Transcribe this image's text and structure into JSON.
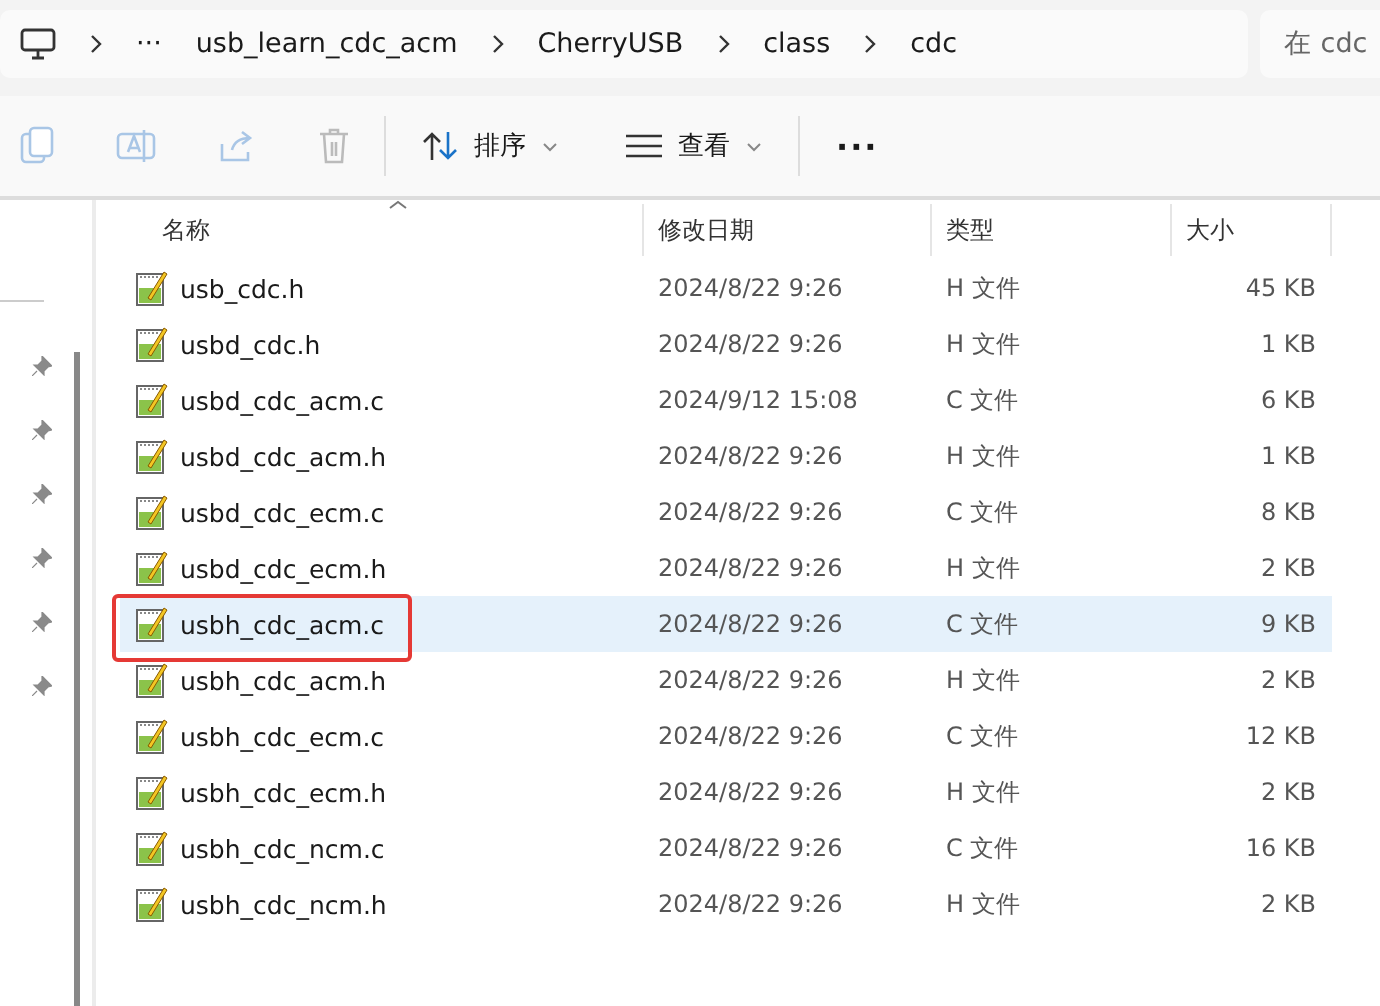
{
  "breadcrumb": {
    "overflow": "···",
    "items": [
      "usb_learn_cdc_acm",
      "CherryUSB",
      "class",
      "cdc"
    ]
  },
  "search": {
    "placeholder": "在 cdc"
  },
  "toolbar": {
    "sort": "排序",
    "view": "查看",
    "more": "···"
  },
  "table": {
    "columns": [
      "名称",
      "修改日期",
      "类型",
      "大小"
    ],
    "rows": [
      {
        "name": "usb_cdc.h",
        "date": "2024/8/22 9:26",
        "type": "H 文件",
        "size": "45 KB",
        "selected": false,
        "marked": false
      },
      {
        "name": "usbd_cdc.h",
        "date": "2024/8/22 9:26",
        "type": "H 文件",
        "size": "1 KB",
        "selected": false,
        "marked": false
      },
      {
        "name": "usbd_cdc_acm.c",
        "date": "2024/9/12 15:08",
        "type": "C 文件",
        "size": "6 KB",
        "selected": false,
        "marked": false
      },
      {
        "name": "usbd_cdc_acm.h",
        "date": "2024/8/22 9:26",
        "type": "H 文件",
        "size": "1 KB",
        "selected": false,
        "marked": false
      },
      {
        "name": "usbd_cdc_ecm.c",
        "date": "2024/8/22 9:26",
        "type": "C 文件",
        "size": "8 KB",
        "selected": false,
        "marked": false
      },
      {
        "name": "usbd_cdc_ecm.h",
        "date": "2024/8/22 9:26",
        "type": "H 文件",
        "size": "2 KB",
        "selected": false,
        "marked": false
      },
      {
        "name": "usbh_cdc_acm.c",
        "date": "2024/8/22 9:26",
        "type": "C 文件",
        "size": "9 KB",
        "selected": true,
        "marked": true
      },
      {
        "name": "usbh_cdc_acm.h",
        "date": "2024/8/22 9:26",
        "type": "H 文件",
        "size": "2 KB",
        "selected": false,
        "marked": false
      },
      {
        "name": "usbh_cdc_ecm.c",
        "date": "2024/8/22 9:26",
        "type": "C 文件",
        "size": "12 KB",
        "selected": false,
        "marked": false
      },
      {
        "name": "usbh_cdc_ecm.h",
        "date": "2024/8/22 9:26",
        "type": "H 文件",
        "size": "2 KB",
        "selected": false,
        "marked": false
      },
      {
        "name": "usbh_cdc_ncm.c",
        "date": "2024/8/22 9:26",
        "type": "C 文件",
        "size": "16 KB",
        "selected": false,
        "marked": false
      },
      {
        "name": "usbh_cdc_ncm.h",
        "date": "2024/8/22 9:26",
        "type": "H 文件",
        "size": "2 KB",
        "selected": false,
        "marked": false
      }
    ]
  }
}
